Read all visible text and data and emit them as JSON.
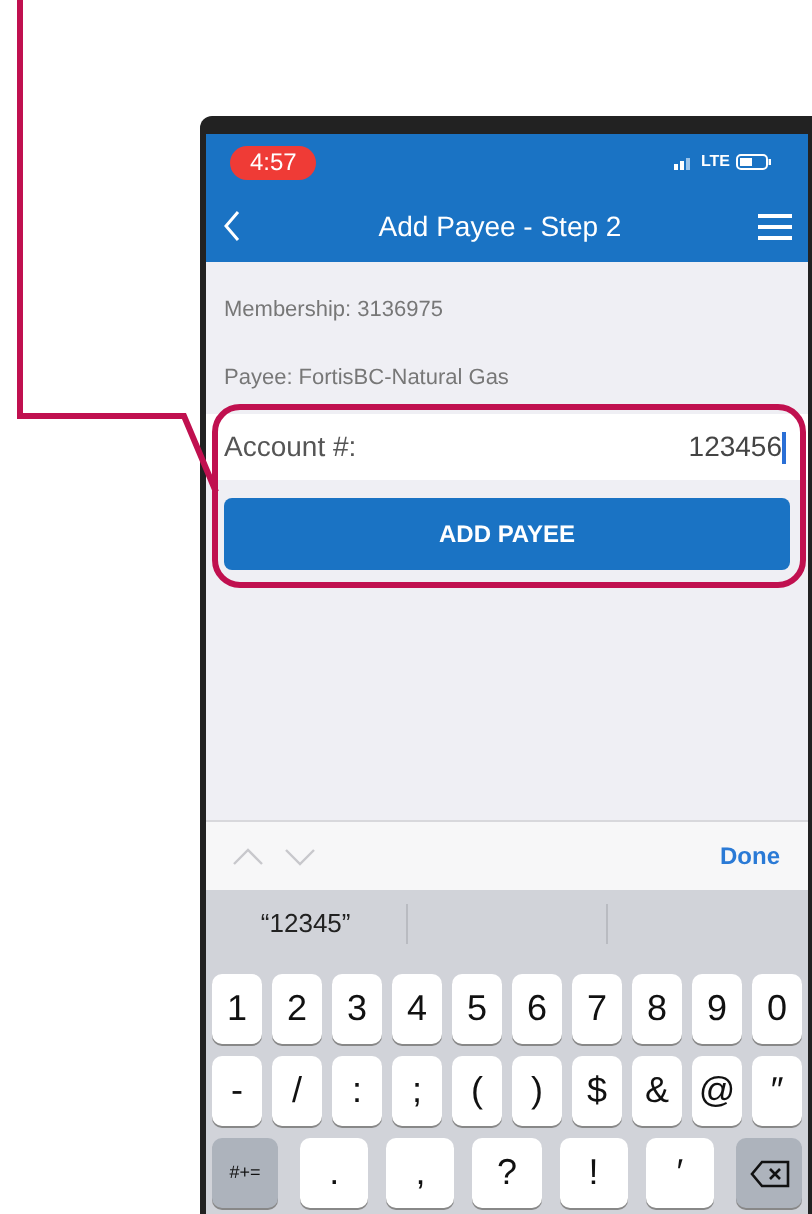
{
  "status_bar": {
    "time": "4:57",
    "network": "LTE"
  },
  "nav_bar": {
    "title": "Add Payee - Step 2"
  },
  "info_lines": [
    "Membership: 3136975",
    "Payee: FortisBC-Natural Gas"
  ],
  "account_field": {
    "label": "Account #:",
    "value": "123456"
  },
  "submit_button": {
    "label": "ADD PAYEE"
  },
  "keyboard_toolbar": {
    "done": "Done"
  },
  "suggestions": [
    "“12345”"
  ],
  "keyboard_rows": [
    [
      {
        "kind": "char",
        "label": "1"
      },
      {
        "kind": "char",
        "label": "2"
      },
      {
        "kind": "char",
        "label": "3"
      },
      {
        "kind": "char",
        "label": "4"
      },
      {
        "kind": "char",
        "label": "5"
      },
      {
        "kind": "char",
        "label": "6"
      },
      {
        "kind": "char",
        "label": "7"
      },
      {
        "kind": "char",
        "label": "8"
      },
      {
        "kind": "char",
        "label": "9"
      },
      {
        "kind": "char",
        "label": "0"
      }
    ],
    [
      {
        "kind": "char",
        "label": "-"
      },
      {
        "kind": "char",
        "label": "/"
      },
      {
        "kind": "char",
        "label": ":"
      },
      {
        "kind": "char",
        "label": ";"
      },
      {
        "kind": "char",
        "label": "("
      },
      {
        "kind": "char",
        "label": ")"
      },
      {
        "kind": "char",
        "label": "$"
      },
      {
        "kind": "char",
        "label": "&"
      },
      {
        "kind": "char",
        "label": "@"
      },
      {
        "kind": "char",
        "label": "″"
      }
    ],
    [
      {
        "kind": "mode",
        "label": "#+="
      },
      {
        "kind": "char",
        "label": "."
      },
      {
        "kind": "char",
        "label": ","
      },
      {
        "kind": "char",
        "label": "?"
      },
      {
        "kind": "char",
        "label": "!"
      },
      {
        "kind": "char",
        "label": "′"
      },
      {
        "kind": "delete"
      }
    ]
  ]
}
